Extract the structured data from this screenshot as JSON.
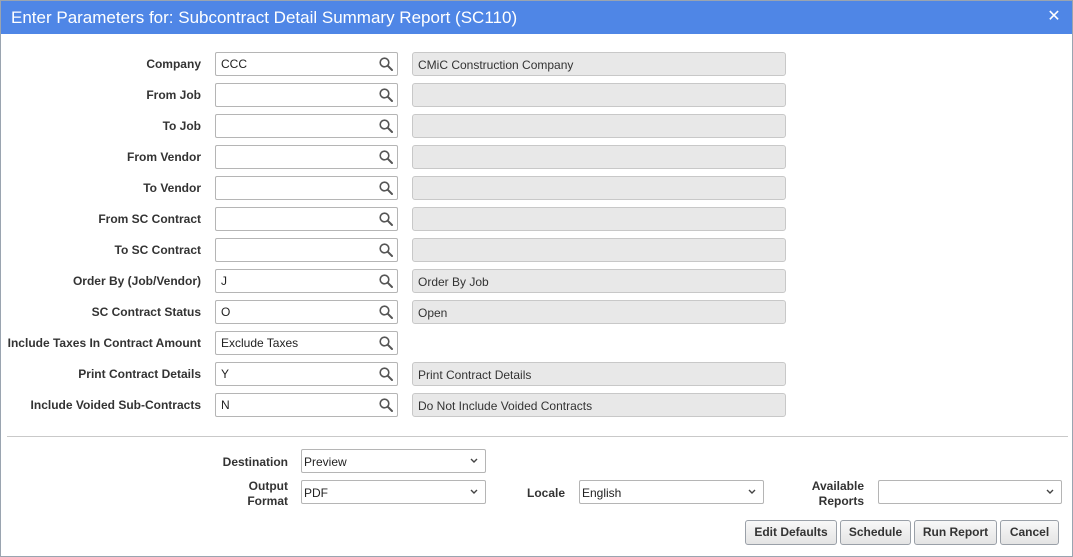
{
  "dialog": {
    "title": "Enter Parameters for: Subcontract Detail Summary Report (SC110)",
    "close_glyph": "✕"
  },
  "params": [
    {
      "label": "Company",
      "value": "CCC",
      "desc": "CMiC Construction Company"
    },
    {
      "label": "From Job",
      "value": "",
      "desc": ""
    },
    {
      "label": "To Job",
      "value": "",
      "desc": ""
    },
    {
      "label": "From Vendor",
      "value": "",
      "desc": ""
    },
    {
      "label": "To Vendor",
      "value": "",
      "desc": ""
    },
    {
      "label": "From SC Contract",
      "value": "",
      "desc": ""
    },
    {
      "label": "To SC Contract",
      "value": "",
      "desc": ""
    },
    {
      "label": "Order By (Job/Vendor)",
      "value": "J",
      "desc": "Order By Job"
    },
    {
      "label": "SC Contract Status",
      "value": "O",
      "desc": "Open"
    },
    {
      "label": "Include Taxes In Contract Amount",
      "value": "Exclude Taxes"
    },
    {
      "label": "Print Contract Details",
      "value": "Y",
      "desc": "Print Contract Details"
    },
    {
      "label": "Include Voided Sub-Contracts",
      "value": "N",
      "desc": "Do Not Include Voided Contracts"
    }
  ],
  "output": {
    "destination_label": "Destination",
    "destination_value": "Preview",
    "format_label_1": "Output",
    "format_label_2": "Format",
    "format_value": "PDF",
    "locale_label": "Locale",
    "locale_value": "English",
    "available_label_1": "Available",
    "available_label_2": "Reports",
    "available_value": ""
  },
  "buttons": {
    "edit_defaults": "Edit Defaults",
    "schedule": "Schedule",
    "run_report": "Run Report",
    "cancel": "Cancel"
  },
  "colors": {
    "titlebar": "#4f86e6",
    "readonly_bg": "#e8e8e8"
  },
  "icons": {
    "lookup": "magnifier-icon",
    "dropdown": "chevron-down-icon",
    "close": "close-icon"
  }
}
